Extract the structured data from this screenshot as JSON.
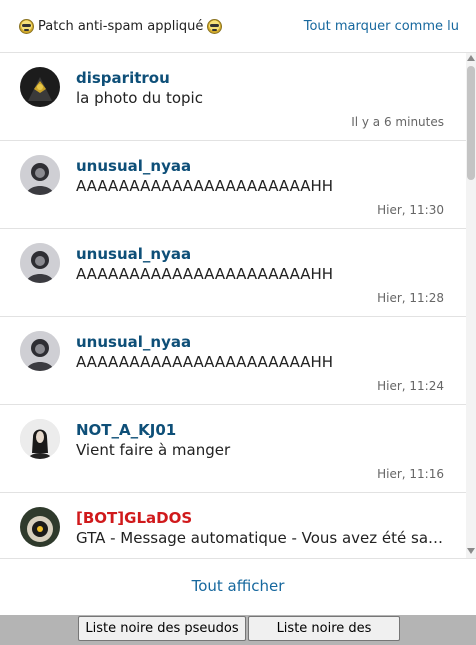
{
  "header": {
    "title": "Patch anti-spam appliqué",
    "mark_all_read": "Tout marquer comme lu"
  },
  "notifications": [
    {
      "user": "disparitrou",
      "message": "la photo du topic",
      "time": "Il y a 6 minutes"
    },
    {
      "user": "unusual_nyaa",
      "message": "AAAAAAAAAAAAAAAAAAAAAAHH",
      "time": "Hier, 11:30"
    },
    {
      "user": "unusual_nyaa",
      "message": "AAAAAAAAAAAAAAAAAAAAAAHH",
      "time": "Hier, 11:28"
    },
    {
      "user": "unusual_nyaa",
      "message": "AAAAAAAAAAAAAAAAAAAAAAHH",
      "time": "Hier, 11:24"
    },
    {
      "user": "NOT_A_KJ01",
      "message": "Vient faire à manger",
      "time": "Hier, 11:16"
    },
    {
      "user": "[BOT]GLaDOS",
      "message": "GTA - Message automatique - Vous avez été sa…",
      "time": ""
    }
  ],
  "footer": {
    "show_all": "Tout afficher"
  },
  "bottom_bar": {
    "pseudos_button": "Liste noire des pseudos",
    "objets_button": "Liste noire des objets"
  },
  "colors": {
    "link": "#17689e",
    "username": "#0e4f78",
    "bot_username": "#d0191b"
  }
}
